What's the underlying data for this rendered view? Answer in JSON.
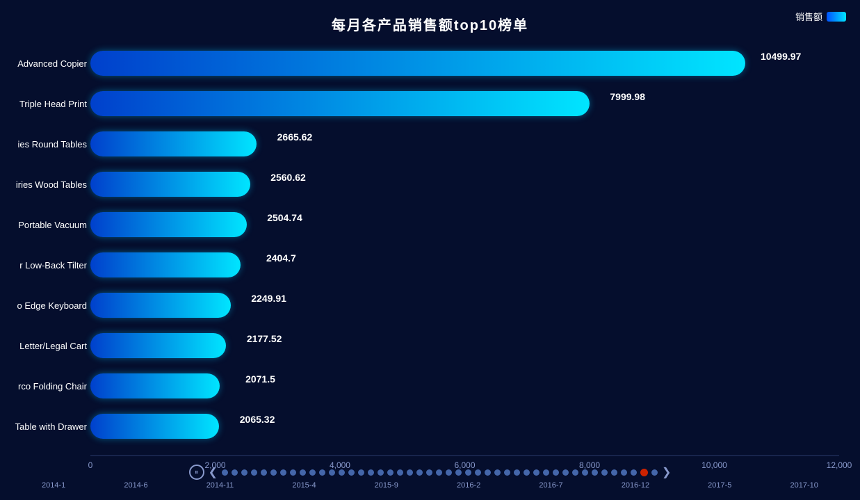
{
  "title": "每月各产品销售额top10榜单",
  "legend": {
    "label": "销售额",
    "color_start": "#0050ff",
    "color_end": "#00e5ff"
  },
  "chart": {
    "max_value": 12000,
    "x_ticks": [
      {
        "label": "0",
        "pct": 0
      },
      {
        "label": "2,000",
        "pct": 16.67
      },
      {
        "label": "4,000",
        "pct": 33.33
      },
      {
        "label": "6,000",
        "pct": 50
      },
      {
        "label": "8,000",
        "pct": 66.67
      },
      {
        "label": "10,000",
        "pct": 83.33
      },
      {
        "label": "12,000",
        "pct": 100
      }
    ],
    "bars": [
      {
        "label": "Advanced Copier",
        "value": 10499.97,
        "display": "10499.97"
      },
      {
        "label": "Triple Head Print",
        "value": 7999.98,
        "display": "7999.98"
      },
      {
        "label": "ies Round Tables",
        "value": 2665.62,
        "display": "2665.62"
      },
      {
        "label": "iries Wood Tables",
        "value": 2560.62,
        "display": "2560.62"
      },
      {
        "label": "Portable Vacuum",
        "value": 2504.74,
        "display": "2504.74"
      },
      {
        "label": "r Low-Back Tilter",
        "value": 2404.7,
        "display": "2404.7"
      },
      {
        "label": "o Edge Keyboard",
        "value": 2249.91,
        "display": "2249.91"
      },
      {
        "label": "Letter/Legal Cart",
        "value": 2177.52,
        "display": "2177.52"
      },
      {
        "label": "rco Folding Chair",
        "value": 2071.5,
        "display": "2071.5"
      },
      {
        "label": "Table with Drawer",
        "value": 2065.32,
        "display": "2065.32"
      }
    ]
  },
  "timeline": {
    "play_icon": "⏸",
    "prev_icon": "❮",
    "next_icon": "❯",
    "dots_count": 45,
    "active_dot": 43,
    "labels": [
      "2014-1",
      "2014-6",
      "2014-11",
      "2015-4",
      "2015-9",
      "2016-2",
      "2016-7",
      "2016-12",
      "2017-5",
      "2017-10"
    ]
  }
}
